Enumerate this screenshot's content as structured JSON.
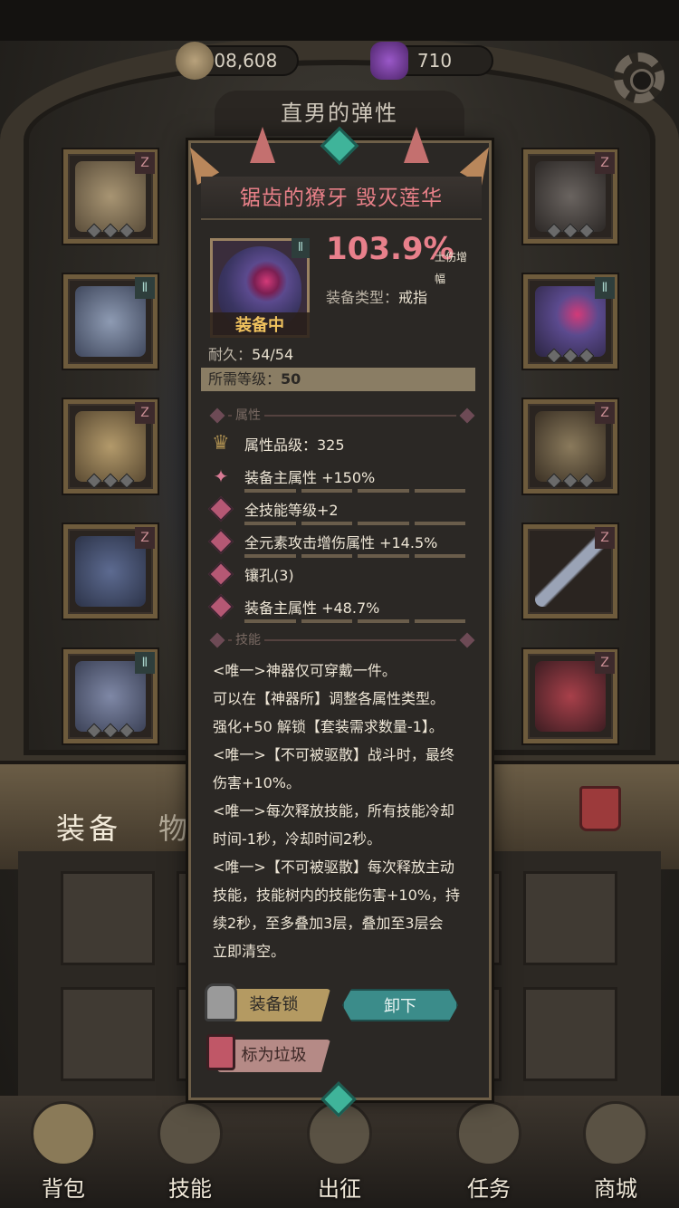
{
  "currency": {
    "gold": "408,608",
    "gems": "710"
  },
  "page_title": "直男的弹性",
  "left_slots": [
    {
      "name": "helmet",
      "badge": "Z"
    },
    {
      "name": "armor",
      "badge": "Ⅱ"
    },
    {
      "name": "shoulder",
      "badge": "Z"
    },
    {
      "name": "pants",
      "badge": "Z"
    },
    {
      "name": "boots",
      "badge": "Ⅱ"
    }
  ],
  "right_slots": [
    {
      "name": "mask",
      "badge": "Z"
    },
    {
      "name": "ring",
      "badge": "Ⅱ"
    },
    {
      "name": "amulet",
      "badge": "Z"
    },
    {
      "name": "weapon",
      "badge": "Z"
    },
    {
      "name": "artifact",
      "badge": "Z"
    }
  ],
  "tabs": {
    "equipment": "装备",
    "items": "物品"
  },
  "nav": [
    {
      "label": "背包"
    },
    {
      "label": "技能"
    },
    {
      "label": "出征"
    },
    {
      "label": "任务"
    },
    {
      "label": "商城"
    }
  ],
  "item": {
    "name": "锯齿的獠牙 毁灭莲华",
    "badge": "Ⅱ",
    "equipped_label": "装备中",
    "percent": "103.9%",
    "percent_unit": "土伤增幅",
    "type_label": "装备类型：",
    "type_value": "戒指",
    "durability_label": "耐久：",
    "durability_value": "54/54",
    "level_label": "所需等级：",
    "level_value": "50",
    "attr_section": "属性",
    "attrs": [
      {
        "text": "属性品级：325"
      },
      {
        "text": "装备主属性 +150%"
      },
      {
        "text": "全技能等级+2"
      },
      {
        "text": "全元素攻击增伤属性 +14.5%"
      },
      {
        "text": "镶孔(3)"
      },
      {
        "text": "装备主属性 +48.7%"
      }
    ],
    "skill_section": "技能",
    "skill_lines": [
      "<唯一>神器仅可穿戴一件。",
      "可以在【神器所】调整各属性类型。",
      "强化+50 解锁【套装需求数量-1】。",
      "<唯一>【不可被驱散】战斗时，最终",
      "伤害+10%。",
      "<唯一>每次释放技能，所有技能冷却",
      "时间-1秒，冷却时间2秒。",
      "<唯一>【不可被驱散】每次释放主动",
      "技能，技能树内的技能伤害+10%，持",
      "续2秒，至多叠加3层，叠加至3层会",
      "立即清空。"
    ],
    "btn_lock": "装备锁",
    "btn_unequip": "卸下",
    "btn_trash": "标为垃圾"
  },
  "colors": {
    "accent_pink": "#e8808b",
    "teal": "#3b8c8a",
    "gold": "#f0c25e"
  }
}
